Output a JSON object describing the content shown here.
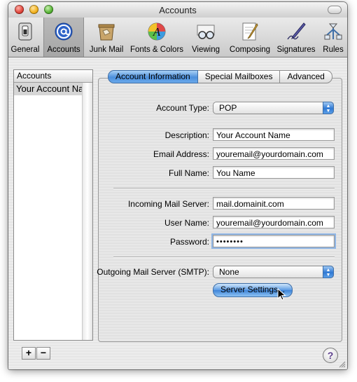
{
  "window": {
    "title": "Accounts"
  },
  "toolbar": {
    "items": [
      {
        "label": "General",
        "icon": "general-switch-icon"
      },
      {
        "label": "Accounts",
        "icon": "at-sign-icon",
        "selected": true
      },
      {
        "label": "Junk Mail",
        "icon": "junk-mail-icon"
      },
      {
        "label": "Fonts & Colors",
        "icon": "fonts-colors-icon"
      },
      {
        "label": "Viewing",
        "icon": "viewing-glasses-icon"
      },
      {
        "label": "Composing",
        "icon": "composing-pencil-icon"
      },
      {
        "label": "Signatures",
        "icon": "signature-pen-icon"
      },
      {
        "label": "Rules",
        "icon": "rules-icon"
      }
    ]
  },
  "sidebar": {
    "header": "Accounts",
    "accounts": [
      "Your Account Name"
    ],
    "add_label": "+",
    "remove_label": "−"
  },
  "tabs": {
    "items": [
      "Account Information",
      "Special Mailboxes",
      "Advanced"
    ],
    "active": "Account Information"
  },
  "form": {
    "account_type_label": "Account Type:",
    "account_type_value": "POP",
    "description_label": "Description:",
    "description_value": "Your Account Name",
    "email_label": "Email Address:",
    "email_value": "youremail@yourdomain.com",
    "fullname_label": "Full Name:",
    "fullname_value": "You Name",
    "incoming_label": "Incoming Mail Server:",
    "incoming_value": "mail.domainit.com",
    "username_label": "User Name:",
    "username_value": "youremail@yourdomain.com",
    "password_label": "Password:",
    "password_value": "••••••••",
    "smtp_label": "Outgoing Mail Server (SMTP):",
    "smtp_value": "None",
    "server_settings_label": "Server Settings..."
  },
  "help": {
    "label": "?"
  },
  "colors": {
    "accent_blue": "#4b8fdc",
    "window_bg": "#ececec"
  }
}
